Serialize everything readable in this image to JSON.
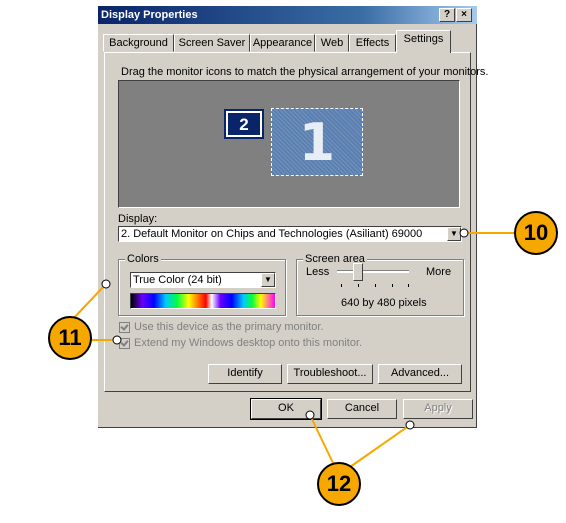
{
  "window": {
    "title": "Display Properties",
    "help_button": "?",
    "close_button": "×"
  },
  "tabs": [
    "Background",
    "Screen Saver",
    "Appearance",
    "Web",
    "Effects",
    "Settings"
  ],
  "active_tab": "Settings",
  "instruction": "Drag the monitor icons to match the physical arrangement of your monitors.",
  "monitors": {
    "secondary_label": "2",
    "primary_label": "1"
  },
  "display": {
    "label": "Display:",
    "value": "2. Default Monitor on Chips and Technologies (Asiliant) 69000"
  },
  "colors": {
    "group_label": "Colors",
    "value": "True Color (24 bit)"
  },
  "screen_area": {
    "group_label": "Screen area",
    "less_label": "Less",
    "more_label": "More",
    "resolution": "640 by 480 pixels",
    "slider_level": 0.25
  },
  "checkboxes": {
    "primary": "Use this device as the primary monitor.",
    "extend": "Extend my Windows desktop onto this monitor."
  },
  "buttons": {
    "identify": "Identify",
    "troubleshoot": "Troubleshoot...",
    "advanced": "Advanced...",
    "ok": "OK",
    "cancel": "Cancel",
    "apply": "Apply"
  },
  "callouts": [
    "10",
    "11",
    "12"
  ],
  "colors_theme": {
    "callout_fill": "#f7a800",
    "dialog_bg": "#d4d0c8",
    "title_bar": "#0a246a"
  }
}
